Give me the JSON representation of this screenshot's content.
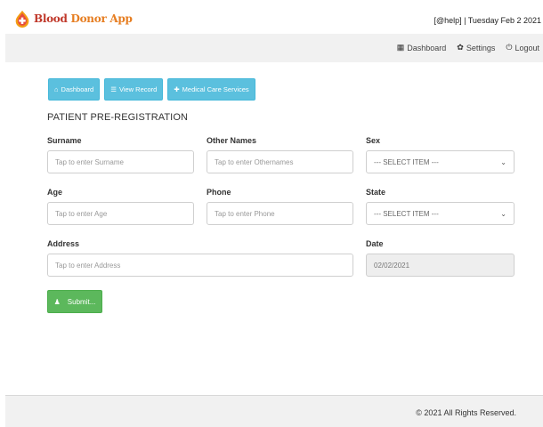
{
  "header": {
    "app_name_part1": "Blood",
    "app_name_part2": "Donor",
    "app_name_part3": "App",
    "help_text": "[@help] | Tuesday Feb 2 2021"
  },
  "nav": {
    "dashboard": "Dashboard",
    "settings": "Settings",
    "logout": "Logout"
  },
  "tabs": {
    "dashboard": "Dashboard",
    "view_record": "View Record",
    "medical_care": "Medical Care Services"
  },
  "form": {
    "title": "PATIENT PRE-REGISTRATION",
    "surname_label": "Surname",
    "surname_placeholder": "Tap to enter Surname",
    "other_names_label": "Other Names",
    "other_names_placeholder": "Tap to enter Othernames",
    "sex_label": "Sex",
    "sex_value": "--- SELECT ITEM ---",
    "age_label": "Age",
    "age_placeholder": "Tap to enter Age",
    "phone_label": "Phone",
    "phone_placeholder": "Tap to enter Phone",
    "state_label": "State",
    "state_value": "--- SELECT ITEM ---",
    "address_label": "Address",
    "address_placeholder": "Tap to enter Address",
    "date_label": "Date",
    "date_value": "02/02/2021",
    "submit_label": "Submit..."
  },
  "footer": {
    "copyright": "© 2021 All Rights Reserved."
  },
  "colors": {
    "tab_button": "#5bc0de",
    "submit_button": "#5cb85c",
    "brand_red": "#c0392b",
    "brand_orange": "#e67e22"
  }
}
